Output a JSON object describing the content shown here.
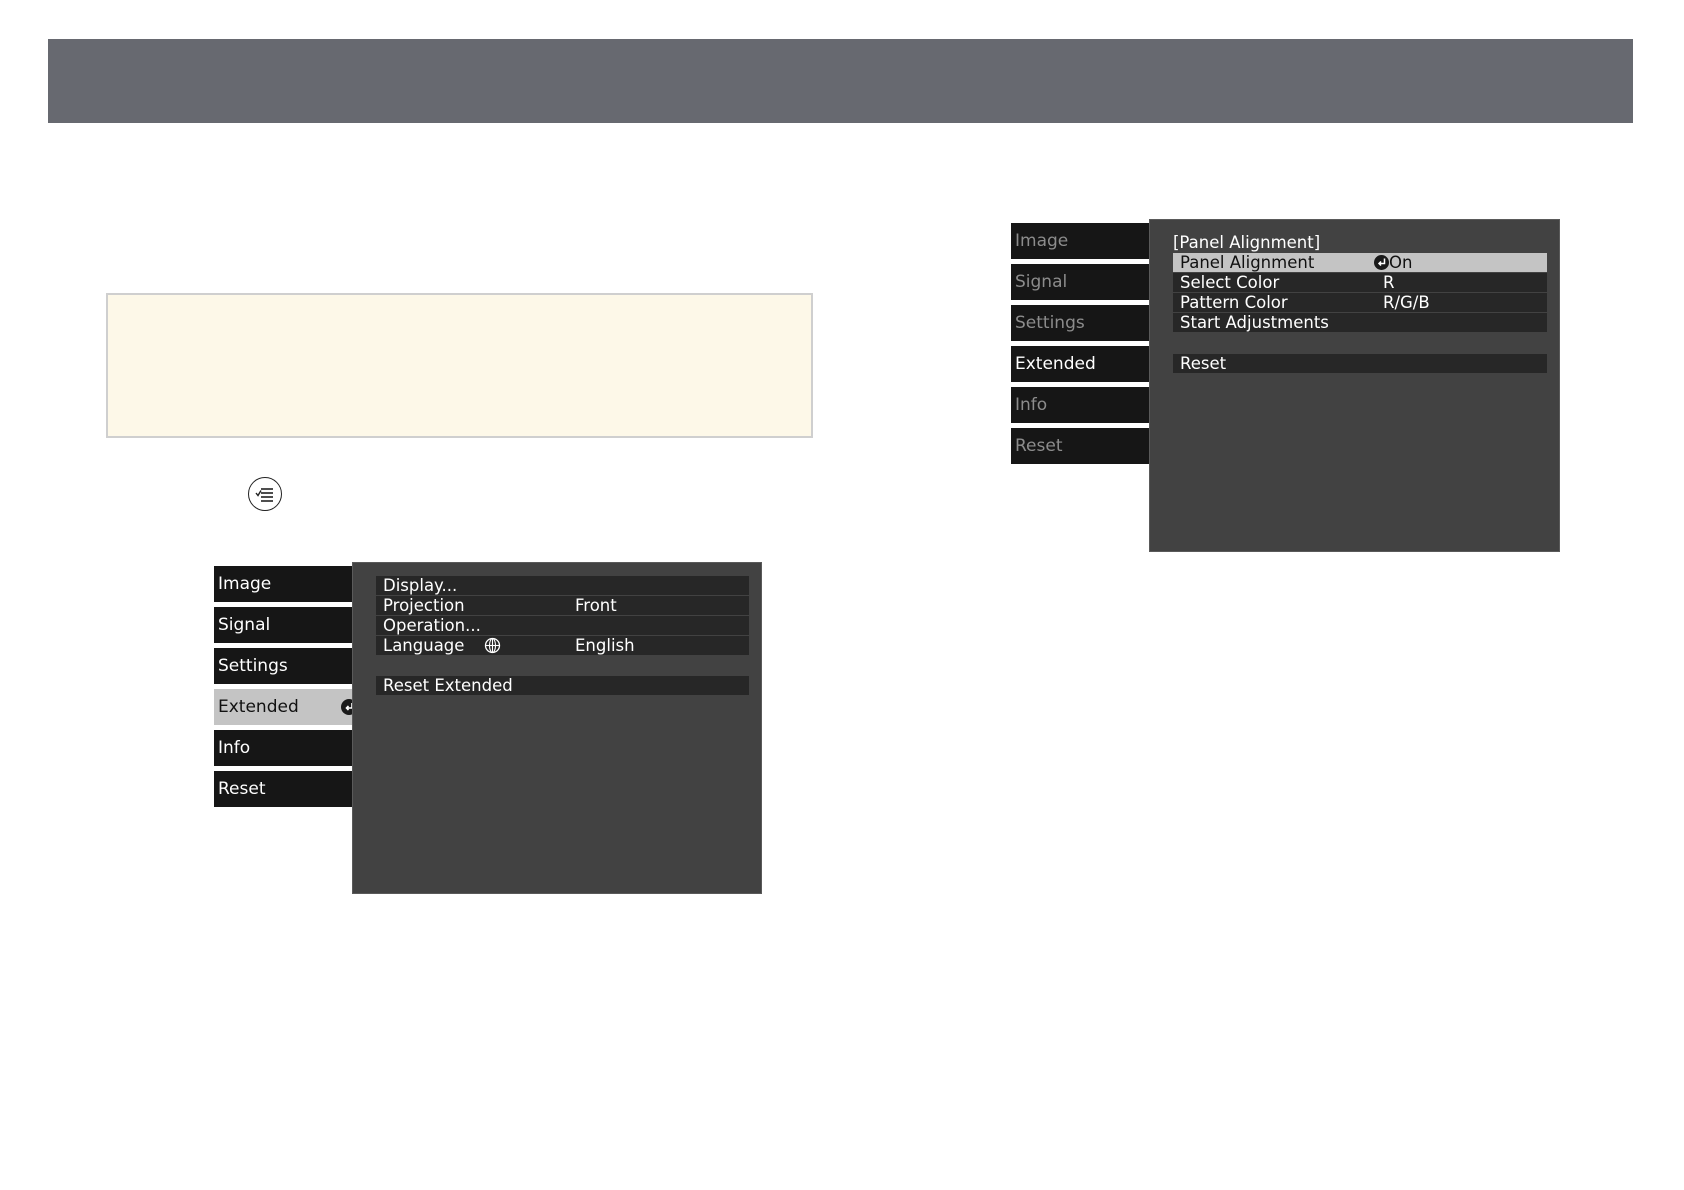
{
  "colors": {
    "header_bar": "#676970",
    "note_background": "#fdf8e8",
    "osd_panel": "#424242",
    "osd_row": "#272727",
    "osd_tab": "#161616",
    "osd_highlight": "#c4c4c4"
  },
  "icons": {
    "menu_button": "menu-button-icon",
    "enter": "enter-icon",
    "language": "globe-icon"
  },
  "menu1": {
    "tabs": [
      "Image",
      "Signal",
      "Settings",
      "Extended",
      "Info",
      "Reset"
    ],
    "selected_tab": "Extended",
    "items": [
      {
        "label": "Display...",
        "value": ""
      },
      {
        "label": "Projection",
        "value": "Front"
      },
      {
        "label": "Operation...",
        "value": ""
      },
      {
        "label": "Language",
        "value": "English"
      }
    ],
    "reset_label": "Reset Extended"
  },
  "menu2": {
    "tabs": [
      "Image",
      "Signal",
      "Settings",
      "Extended",
      "Info",
      "Reset"
    ],
    "selected_tab": "Extended",
    "title": "[Panel Alignment]",
    "items": [
      {
        "label": "Panel Alignment",
        "value": "On"
      },
      {
        "label": "Select Color",
        "value": "R"
      },
      {
        "label": "Pattern Color",
        "value": "R/G/B"
      },
      {
        "label": "Start Adjustments",
        "value": ""
      }
    ],
    "reset_label": "Reset"
  }
}
